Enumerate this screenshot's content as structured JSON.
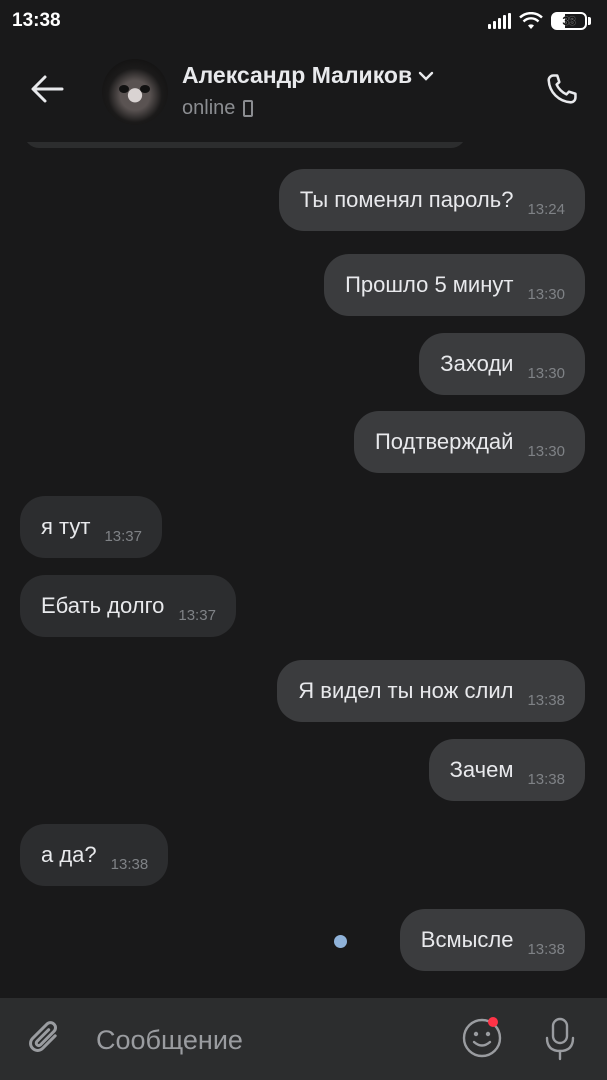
{
  "status_bar": {
    "time": "13:38",
    "battery": "33",
    "icons": [
      "signal-icon",
      "wifi-icon",
      "battery-icon"
    ]
  },
  "header": {
    "contact_name": "Александр Маликов",
    "status": "online",
    "icons": [
      "back-arrow-icon",
      "chevron-down-icon",
      "mobile-device-icon",
      "phone-icon"
    ]
  },
  "messages": [
    {
      "direction": "out",
      "text": "Ты поменял пароль?",
      "time": "13:24"
    },
    {
      "direction": "out",
      "text": "Прошло 5 минут",
      "time": "13:30"
    },
    {
      "direction": "out",
      "text": "Заходи",
      "time": "13:30"
    },
    {
      "direction": "out",
      "text": "Подтверждай",
      "time": "13:30"
    },
    {
      "direction": "in",
      "text": "я тут",
      "time": "13:37"
    },
    {
      "direction": "in",
      "text": "Ебать долго",
      "time": "13:37"
    },
    {
      "direction": "out",
      "text": "Я видел ты нож слил",
      "time": "13:38"
    },
    {
      "direction": "out",
      "text": "Зачем",
      "time": "13:38"
    },
    {
      "direction": "in",
      "text": "а да?",
      "time": "13:38"
    },
    {
      "direction": "out",
      "text": "Всмысле",
      "time": "13:38",
      "unread": true
    }
  ],
  "composer": {
    "placeholder": "Сообщение",
    "icons": [
      "paperclip-icon",
      "emoji-icon",
      "microphone-icon"
    ]
  },
  "colors": {
    "background": "#19191a",
    "bubble_out": "#3b3c3e",
    "bubble_in": "#2c2d2f",
    "unread_dot": "#8fb2d9",
    "notification_dot": "#ff3347"
  }
}
